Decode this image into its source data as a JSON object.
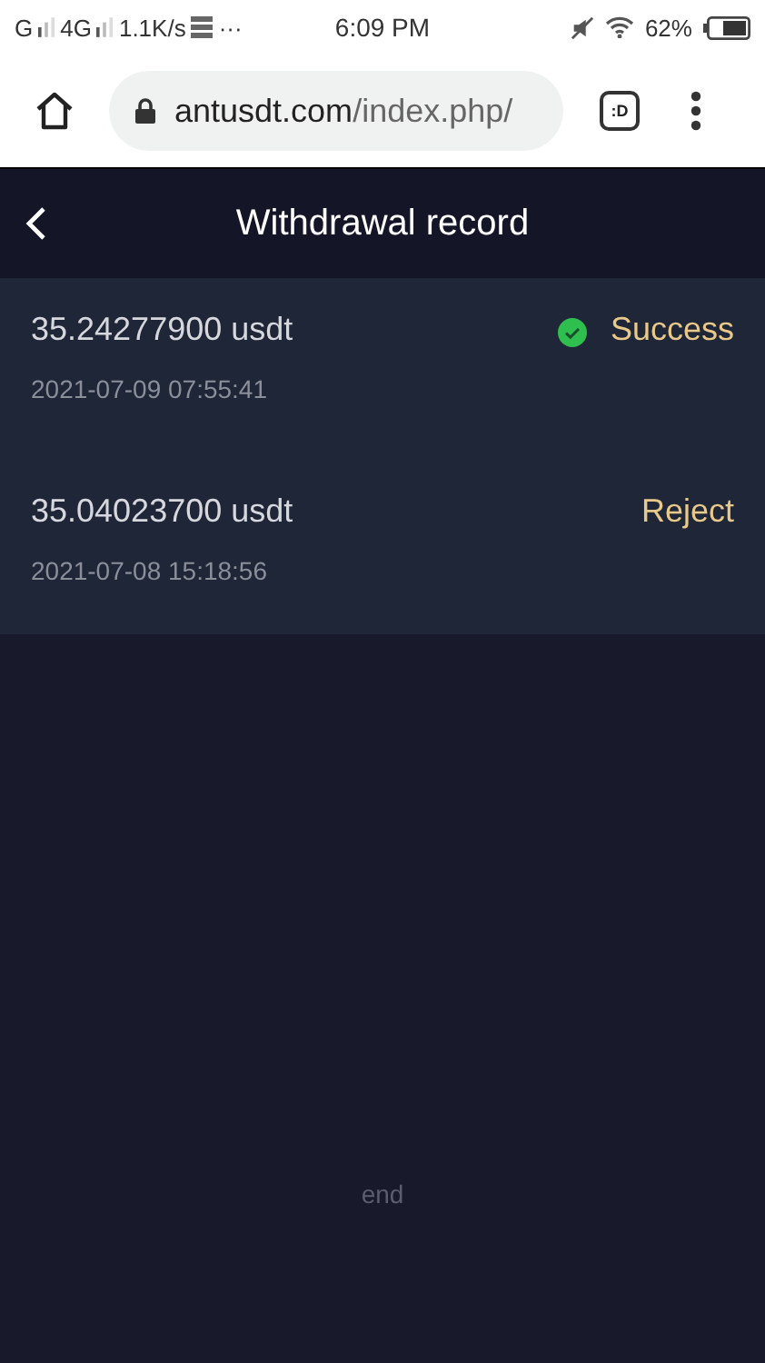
{
  "status_bar": {
    "carrier_1": "G",
    "carrier_2": "4G",
    "speed": "1.1K/s",
    "more": "···",
    "time": "6:09 PM",
    "battery": "62%"
  },
  "browser": {
    "host": "antusdt.com",
    "path": "/index.php/",
    "tabs_label": ":D"
  },
  "header": {
    "title": "Withdrawal record"
  },
  "records": [
    {
      "amount": "35.24277900 usdt",
      "date": "2021-07-09 07:55:41",
      "status": "Success",
      "kind": "success"
    },
    {
      "amount": "35.04023700 usdt",
      "date": "2021-07-08 15:18:56",
      "status": "Reject",
      "kind": "reject"
    }
  ],
  "footer": "end"
}
